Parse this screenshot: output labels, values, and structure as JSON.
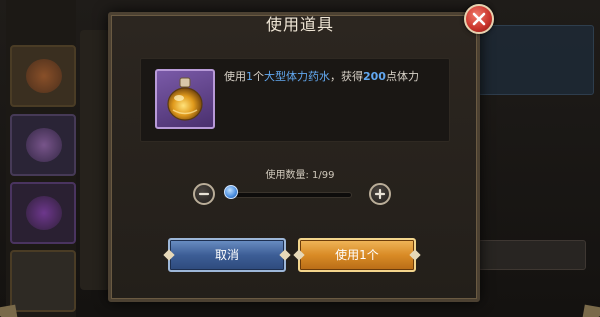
{
  "dialog": {
    "title": "使用道具",
    "description": {
      "prefix": "使用",
      "count": "1",
      "unit": "个",
      "item_name": "大型体力药水",
      "mid": "，获得",
      "amount": "200",
      "suffix": "点体力"
    },
    "item": {
      "icon": "stamina-potion-icon",
      "rarity_color": "#7a5aa8"
    },
    "quantity": {
      "label": "使用数量:",
      "current": 1,
      "max": 99,
      "display": "1/99",
      "slider_fraction": 0.0
    },
    "buttons": {
      "cancel_label": "取消",
      "confirm_label": "使用1个"
    },
    "colors": {
      "highlight": "#62a8f0",
      "cancel_button": "#3d5e96",
      "confirm_button": "#d98b26",
      "close_button": "#c8332a"
    }
  }
}
